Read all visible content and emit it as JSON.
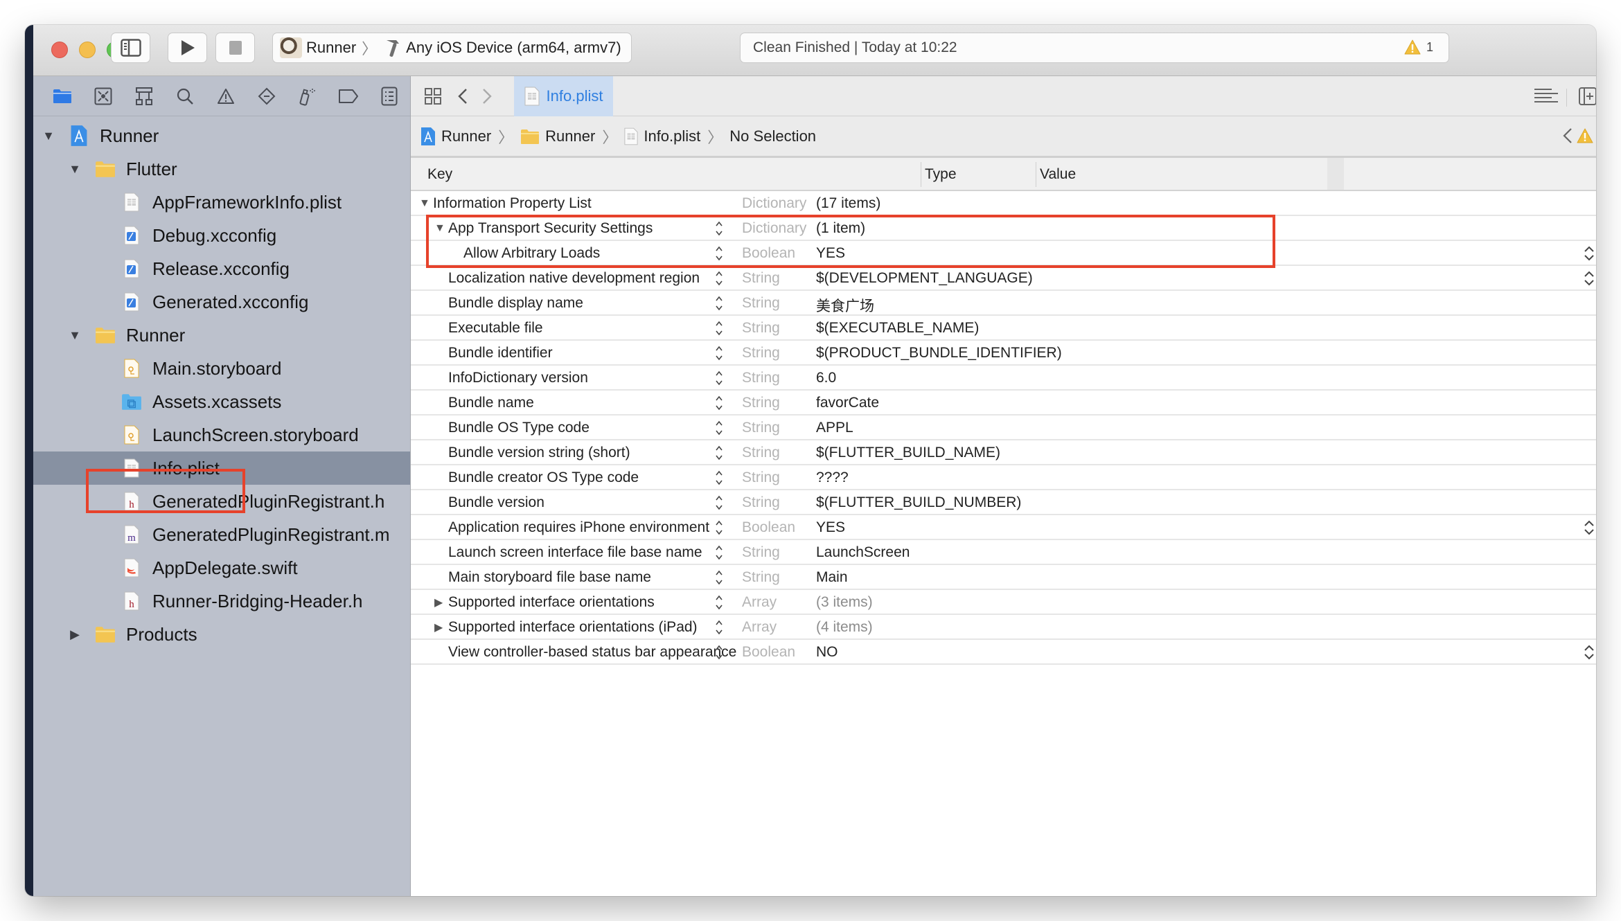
{
  "toolbar": {
    "scheme_name": "Runner",
    "destination": "Any iOS Device (arm64, armv7)",
    "status_text": "Clean Finished | Today at 10:22",
    "warning_count": "1"
  },
  "navigator": {
    "tabs": [
      "project-navigator",
      "source-control-navigator",
      "symbol-navigator",
      "find-navigator",
      "issue-navigator",
      "test-navigator",
      "debug-navigator",
      "breakpoint-navigator",
      "report-navigator"
    ],
    "tree": [
      {
        "label": "Runner",
        "level": 0,
        "icon": "xcodeproj-icon",
        "disclosure": "open"
      },
      {
        "label": "Flutter",
        "level": 1,
        "icon": "folder-icon",
        "disclosure": "open"
      },
      {
        "label": "AppFrameworkInfo.plist",
        "level": 2,
        "icon": "plist-file-icon"
      },
      {
        "label": "Debug.xcconfig",
        "level": 2,
        "icon": "xcconfig-file-icon"
      },
      {
        "label": "Release.xcconfig",
        "level": 2,
        "icon": "xcconfig-file-icon"
      },
      {
        "label": "Generated.xcconfig",
        "level": 2,
        "icon": "xcconfig-file-icon"
      },
      {
        "label": "Runner",
        "level": 1,
        "icon": "folder-icon",
        "disclosure": "open"
      },
      {
        "label": "Main.storyboard",
        "level": 2,
        "icon": "storyboard-file-icon"
      },
      {
        "label": "Assets.xcassets",
        "level": 2,
        "icon": "asset-catalog-icon"
      },
      {
        "label": "LaunchScreen.storyboard",
        "level": 2,
        "icon": "storyboard-file-icon"
      },
      {
        "label": "Info.plist",
        "level": 2,
        "icon": "plist-file-icon",
        "selected": true
      },
      {
        "label": "GeneratedPluginRegistrant.h",
        "level": 2,
        "icon": "header-file-icon"
      },
      {
        "label": "GeneratedPluginRegistrant.m",
        "level": 2,
        "icon": "objc-file-icon"
      },
      {
        "label": "AppDelegate.swift",
        "level": 2,
        "icon": "swift-file-icon"
      },
      {
        "label": "Runner-Bridging-Header.h",
        "level": 2,
        "icon": "header-file-icon"
      },
      {
        "label": "Products",
        "level": 1,
        "icon": "folder-icon",
        "disclosure": "closed"
      }
    ]
  },
  "editor": {
    "active_tab": "Info.plist",
    "breadcrumb": [
      "Runner",
      "Runner",
      "Info.plist",
      "No Selection"
    ],
    "columns": {
      "key": "Key",
      "type": "Type",
      "value": "Value"
    },
    "rows": [
      {
        "key": "Information Property List",
        "type": "Dictionary",
        "value": "(17 items)",
        "level": 0,
        "disclosure": "open",
        "dim_value": false
      },
      {
        "key": "App Transport Security Settings",
        "type": "Dictionary",
        "value": "(1 item)",
        "level": 1,
        "disclosure": "open",
        "dim_value": false
      },
      {
        "key": "Allow Arbitrary Loads",
        "type": "Boolean",
        "value": "YES",
        "level": 2,
        "value_popup": true
      },
      {
        "key": "Localization native development region",
        "type": "String",
        "value": "$(DEVELOPMENT_LANGUAGE)",
        "level": 1,
        "value_popup": true
      },
      {
        "key": "Bundle display name",
        "type": "String",
        "value": "美食广场",
        "level": 1
      },
      {
        "key": "Executable file",
        "type": "String",
        "value": "$(EXECUTABLE_NAME)",
        "level": 1
      },
      {
        "key": "Bundle identifier",
        "type": "String",
        "value": "$(PRODUCT_BUNDLE_IDENTIFIER)",
        "level": 1
      },
      {
        "key": "InfoDictionary version",
        "type": "String",
        "value": "6.0",
        "level": 1
      },
      {
        "key": "Bundle name",
        "type": "String",
        "value": "favorCate",
        "level": 1
      },
      {
        "key": "Bundle OS Type code",
        "type": "String",
        "value": "APPL",
        "level": 1
      },
      {
        "key": "Bundle version string (short)",
        "type": "String",
        "value": "$(FLUTTER_BUILD_NAME)",
        "level": 1
      },
      {
        "key": "Bundle creator OS Type code",
        "type": "String",
        "value": "????",
        "level": 1
      },
      {
        "key": "Bundle version",
        "type": "String",
        "value": "$(FLUTTER_BUILD_NUMBER)",
        "level": 1
      },
      {
        "key": "Application requires iPhone environment",
        "type": "Boolean",
        "value": "YES",
        "level": 1,
        "value_popup": true
      },
      {
        "key": "Launch screen interface file base name",
        "type": "String",
        "value": "LaunchScreen",
        "level": 1
      },
      {
        "key": "Main storyboard file base name",
        "type": "String",
        "value": "Main",
        "level": 1
      },
      {
        "key": "Supported interface orientations",
        "type": "Array",
        "value": "(3 items)",
        "level": 1,
        "disclosure": "closed",
        "dim_value": true
      },
      {
        "key": "Supported interface orientations (iPad)",
        "type": "Array",
        "value": "(4 items)",
        "level": 1,
        "disclosure": "closed",
        "dim_value": true
      },
      {
        "key": "View controller-based status bar appearance",
        "type": "Boolean",
        "value": "NO",
        "level": 1,
        "value_popup": true
      }
    ]
  },
  "annotations": {
    "highlight_color": "#e6422b"
  }
}
